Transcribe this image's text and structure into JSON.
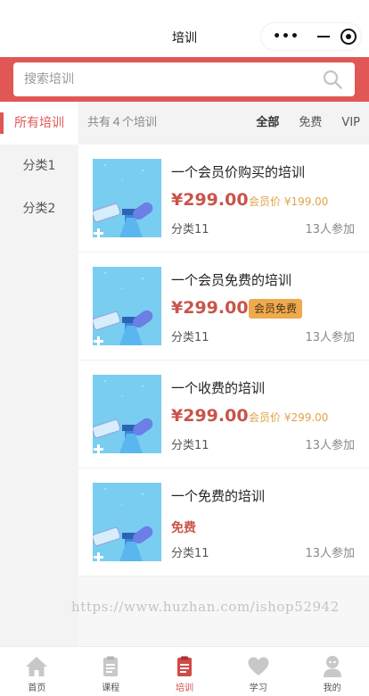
{
  "titlebar": {
    "title": "培训",
    "more": "•••"
  },
  "search": {
    "placeholder": "搜索培训"
  },
  "sidebar": {
    "items": [
      {
        "label": "所有培训"
      },
      {
        "label": "分类1"
      },
      {
        "label": "分类2"
      }
    ]
  },
  "filterbar": {
    "count_text": "共有４个培训",
    "filters": [
      {
        "label": "全部"
      },
      {
        "label": "免费"
      },
      {
        "label": "VIP"
      }
    ]
  },
  "courses": [
    {
      "name": "一个会员价购买的培训",
      "price": "¥299.00",
      "member_price": "会员价 ¥199.00",
      "category": "分类11",
      "enrolled": "13人参加"
    },
    {
      "name": "一个会员免费的培训",
      "price": "¥299.00",
      "badge": "会员免费",
      "category": "分类11",
      "enrolled": "13人参加"
    },
    {
      "name": "一个收费的培训",
      "price": "¥299.00",
      "member_price": "会员价 ¥299.00",
      "category": "分类11",
      "enrolled": "13人参加"
    },
    {
      "name": "一个免费的培训",
      "free": "免费",
      "category": "分类11",
      "enrolled": "13人参加"
    }
  ],
  "watermark": "https://www.huzhan.com/ishop52942",
  "tabbar": {
    "items": [
      {
        "label": "首页",
        "icon": "home-icon"
      },
      {
        "label": "课程",
        "icon": "document-icon"
      },
      {
        "label": "培训",
        "icon": "clipboard-icon"
      },
      {
        "label": "学习",
        "icon": "heart-icon"
      },
      {
        "label": "我的",
        "icon": "user-icon"
      }
    ]
  },
  "colors": {
    "brand": "#e05755",
    "price": "#c9544a",
    "member": "#e0a34a",
    "badge": "#eeaa4d",
    "tab_active": "#d04a45",
    "tab_inactive": "#c8c8c8"
  }
}
